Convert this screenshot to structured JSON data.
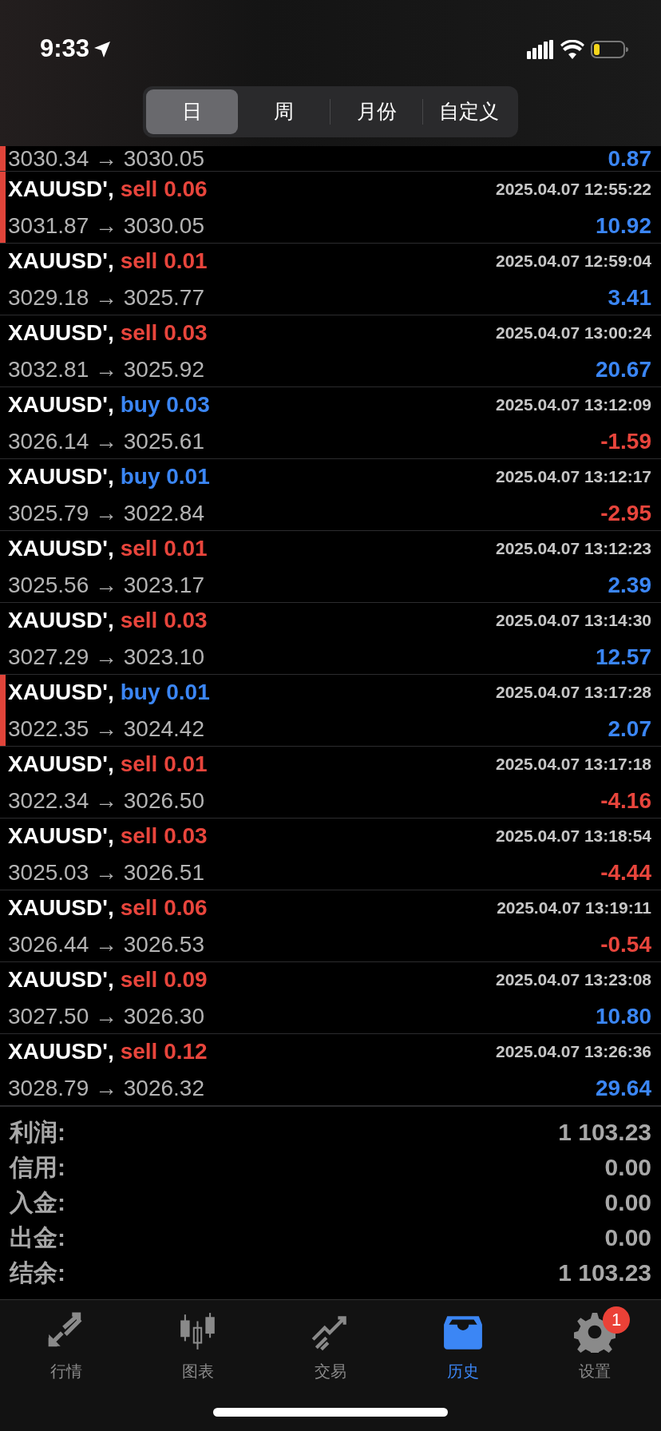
{
  "status_bar": {
    "time": "9:33"
  },
  "period_tabs": [
    {
      "label": "日",
      "selected": true
    },
    {
      "label": "周",
      "selected": false
    },
    {
      "label": "月份",
      "selected": false
    },
    {
      "label": "自定义",
      "selected": false
    }
  ],
  "partial_row": {
    "prices": "3030.34 → 3030.05",
    "profit": {
      "text": "0.87",
      "color": "#3b86f5"
    },
    "marked": true
  },
  "trades": [
    {
      "symbol": "XAUUSD',",
      "order": {
        "text": "sell 0.06",
        "color": "#e8453c"
      },
      "time": "2025.04.07 12:55:22",
      "prices": "3031.87 → 3030.05",
      "profit": {
        "text": "10.92",
        "color": "#3b86f5"
      },
      "marked": true
    },
    {
      "symbol": "XAUUSD',",
      "order": {
        "text": "sell 0.01",
        "color": "#e8453c"
      },
      "time": "2025.04.07 12:59:04",
      "prices": "3029.18 → 3025.77",
      "profit": {
        "text": "3.41",
        "color": "#3b86f5"
      },
      "marked": false
    },
    {
      "symbol": "XAUUSD',",
      "order": {
        "text": "sell 0.03",
        "color": "#e8453c"
      },
      "time": "2025.04.07 13:00:24",
      "prices": "3032.81 → 3025.92",
      "profit": {
        "text": "20.67",
        "color": "#3b86f5"
      },
      "marked": false
    },
    {
      "symbol": "XAUUSD',",
      "order": {
        "text": "buy 0.03",
        "color": "#3b86f5"
      },
      "time": "2025.04.07 13:12:09",
      "prices": "3026.14 → 3025.61",
      "profit": {
        "text": "-1.59",
        "color": "#e8453c"
      },
      "marked": false
    },
    {
      "symbol": "XAUUSD',",
      "order": {
        "text": "buy 0.01",
        "color": "#3b86f5"
      },
      "time": "2025.04.07 13:12:17",
      "prices": "3025.79 → 3022.84",
      "profit": {
        "text": "-2.95",
        "color": "#e8453c"
      },
      "marked": false
    },
    {
      "symbol": "XAUUSD',",
      "order": {
        "text": "sell 0.01",
        "color": "#e8453c"
      },
      "time": "2025.04.07 13:12:23",
      "prices": "3025.56 → 3023.17",
      "profit": {
        "text": "2.39",
        "color": "#3b86f5"
      },
      "marked": false
    },
    {
      "symbol": "XAUUSD',",
      "order": {
        "text": "sell 0.03",
        "color": "#e8453c"
      },
      "time": "2025.04.07 13:14:30",
      "prices": "3027.29 → 3023.10",
      "profit": {
        "text": "12.57",
        "color": "#3b86f5"
      },
      "marked": false
    },
    {
      "symbol": "XAUUSD',",
      "order": {
        "text": "buy 0.01",
        "color": "#3b86f5"
      },
      "time": "2025.04.07 13:17:28",
      "prices": "3022.35 → 3024.42",
      "profit": {
        "text": "2.07",
        "color": "#3b86f5"
      },
      "marked": true
    },
    {
      "symbol": "XAUUSD',",
      "order": {
        "text": "sell 0.01",
        "color": "#e8453c"
      },
      "time": "2025.04.07 13:17:18",
      "prices": "3022.34 → 3026.50",
      "profit": {
        "text": "-4.16",
        "color": "#e8453c"
      },
      "marked": false
    },
    {
      "symbol": "XAUUSD',",
      "order": {
        "text": "sell 0.03",
        "color": "#e8453c"
      },
      "time": "2025.04.07 13:18:54",
      "prices": "3025.03 → 3026.51",
      "profit": {
        "text": "-4.44",
        "color": "#e8453c"
      },
      "marked": false
    },
    {
      "symbol": "XAUUSD',",
      "order": {
        "text": "sell 0.06",
        "color": "#e8453c"
      },
      "time": "2025.04.07 13:19:11",
      "prices": "3026.44 → 3026.53",
      "profit": {
        "text": "-0.54",
        "color": "#e8453c"
      },
      "marked": false
    },
    {
      "symbol": "XAUUSD',",
      "order": {
        "text": "sell 0.09",
        "color": "#e8453c"
      },
      "time": "2025.04.07 13:23:08",
      "prices": "3027.50 → 3026.30",
      "profit": {
        "text": "10.80",
        "color": "#3b86f5"
      },
      "marked": false
    },
    {
      "symbol": "XAUUSD',",
      "order": {
        "text": "sell 0.12",
        "color": "#e8453c"
      },
      "time": "2025.04.07 13:26:36",
      "prices": "3028.79 → 3026.32",
      "profit": {
        "text": "29.64",
        "color": "#3b86f5"
      },
      "marked": false
    }
  ],
  "summary": [
    {
      "label": "利润:",
      "value": "1 103.23"
    },
    {
      "label": "信用:",
      "value": "0.00"
    },
    {
      "label": "入金:",
      "value": "0.00"
    },
    {
      "label": "出金:",
      "value": "0.00"
    },
    {
      "label": "结余:",
      "value": "1 103.23"
    }
  ],
  "tab_bar": [
    {
      "kind": "quotes",
      "label": "行情",
      "selected": false
    },
    {
      "kind": "chart",
      "label": "图表",
      "selected": false
    },
    {
      "kind": "trade",
      "label": "交易",
      "selected": false
    },
    {
      "kind": "history",
      "label": "历史",
      "selected": true
    },
    {
      "kind": "settings",
      "label": "设置",
      "selected": false,
      "badge": "1"
    }
  ]
}
